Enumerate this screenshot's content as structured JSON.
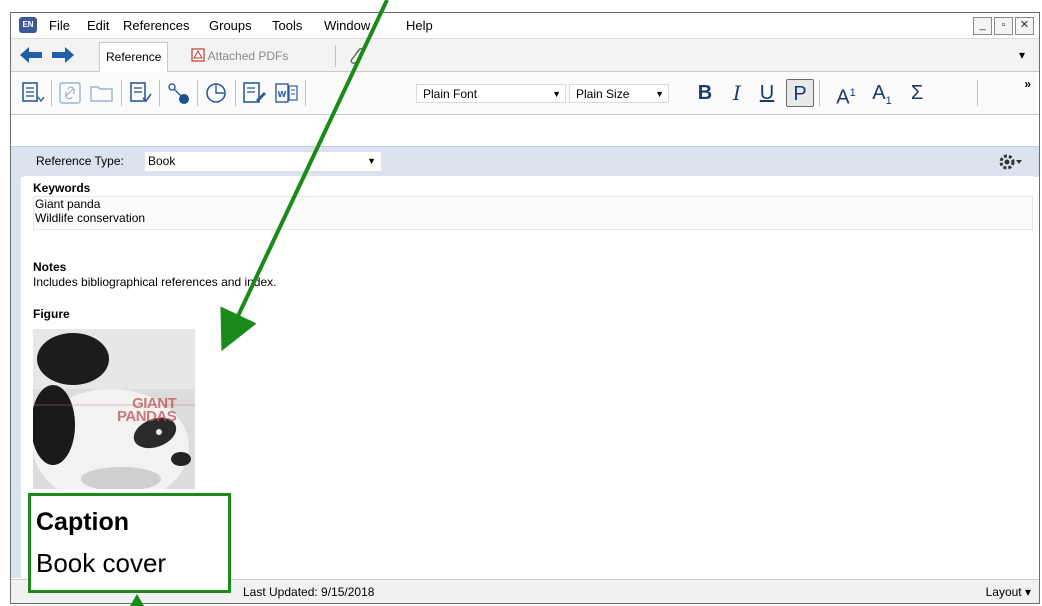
{
  "app": {
    "logo_text": "EN",
    "menu": [
      "File",
      "Edit",
      "References",
      "Groups",
      "Tools",
      "Window",
      "Help"
    ]
  },
  "tabs": {
    "reference": "Reference",
    "attached_pdfs": "Attached PDFs"
  },
  "toolbar": {
    "font": "Plain Font",
    "size": "Plain Size",
    "bold": "B",
    "italic": "I",
    "underline": "U",
    "plain": "P",
    "superscript": "A",
    "superscript_digit": "1",
    "subscript": "A",
    "subscript_digit": "1",
    "symbol": "Σ"
  },
  "reference_type": {
    "label": "Reference Type:",
    "value": "Book"
  },
  "fields": {
    "keywords_label": "Keywords",
    "keywords": [
      "Giant panda",
      "Wildlife conservation"
    ],
    "notes_label": "Notes",
    "notes": "Includes bibliographical references and index.",
    "figure_label": "Figure",
    "figure_cover_title": "GIANT\nPANDAS"
  },
  "status": {
    "last_updated": "Last Updated: 9/15/2018",
    "layout": "Layout"
  },
  "callout": {
    "title": "Caption",
    "value": "Book cover"
  },
  "colors": {
    "accent_blue": "#1f5fa8",
    "annotation_green": "#1a8a1a",
    "panel_blue": "#dbe3ef"
  }
}
